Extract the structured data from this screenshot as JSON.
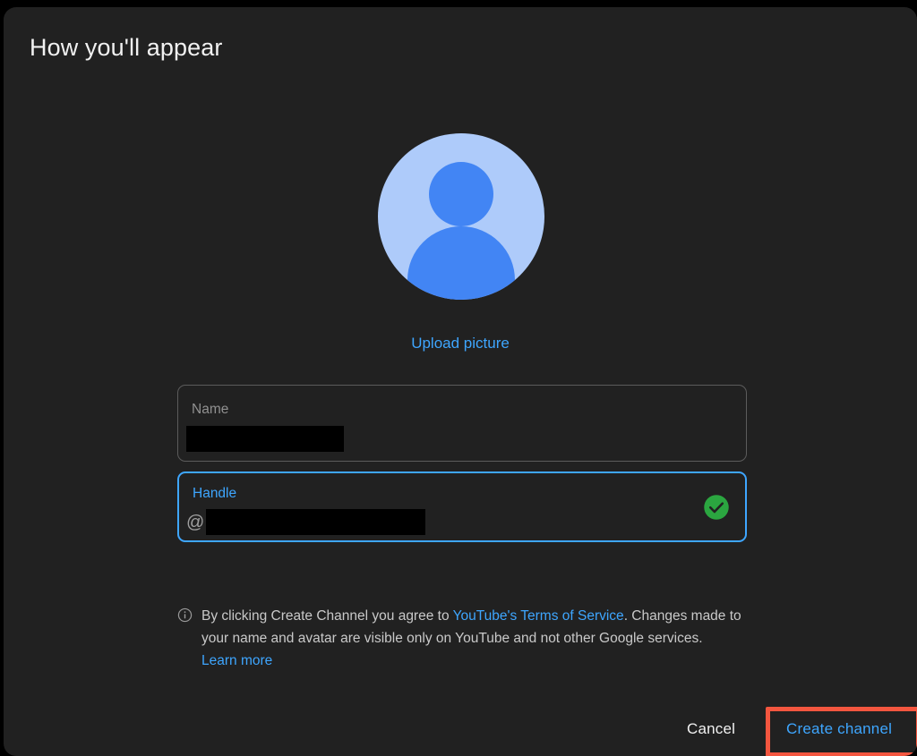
{
  "dialog": {
    "title": "How you'll appear"
  },
  "avatar": {
    "icon": "person-avatar-icon",
    "circle_color": "#aecbfa",
    "figure_color": "#4285f4"
  },
  "upload": {
    "label": "Upload picture",
    "color": "#3ea6ff"
  },
  "fields": {
    "name": {
      "label": "Name",
      "value": "",
      "redacted": true,
      "focused": false,
      "border_color": "#5c5c5c"
    },
    "handle": {
      "label": "Handle",
      "prefix": "@",
      "value": "",
      "redacted": true,
      "focused": true,
      "border_color": "#3ea6ff",
      "validation_icon": "check-circle-icon",
      "validation_color": "#2ba640"
    }
  },
  "terms": {
    "icon": "info-icon",
    "text_part_1": "By clicking Create Channel you agree to ",
    "link_1": "YouTube's Terms of Service",
    "text_part_2": ". Changes made to your name and avatar are visible only on YouTube and not other Google services. ",
    "link_2": "Learn more",
    "link_color": "#3ea6ff"
  },
  "actions": {
    "cancel_label": "Cancel",
    "create_label": "Create channel",
    "create_color": "#3ea6ff",
    "highlight_color": "#f4563f"
  }
}
